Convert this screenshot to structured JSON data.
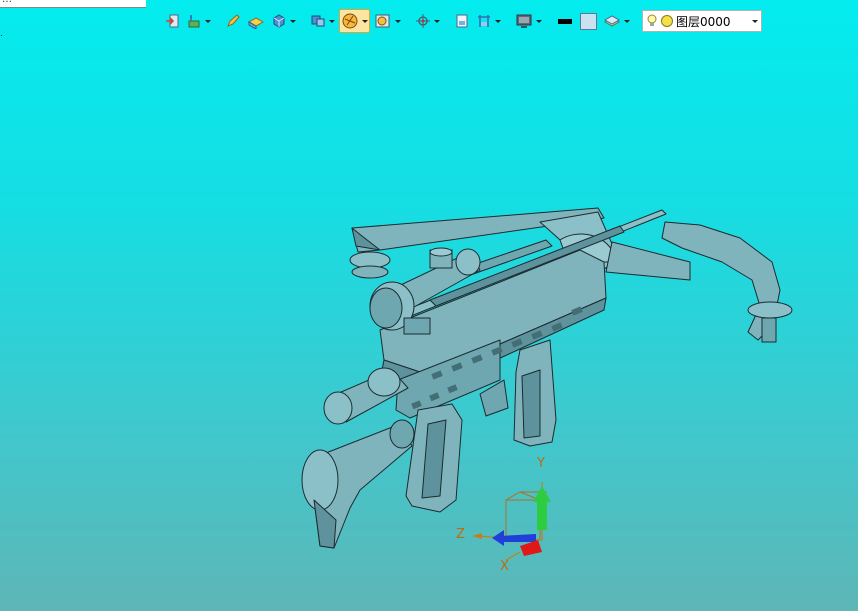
{
  "window": {
    "title_fragment": "…"
  },
  "toolbar": {
    "icons": [
      "exit-icon",
      "snap-icon",
      "pencil-icon",
      "solid-icon",
      "cube-icon",
      "view-cube-icon",
      "render-style-icon",
      "view-orient-icon",
      "pan-target-icon",
      "section-icon",
      "clipping-icon",
      "display-icon",
      "line-color-swatch",
      "fill-color-swatch",
      "layer-settings-icon"
    ],
    "layer": {
      "value": "图层0000"
    }
  },
  "viewport": {
    "background_top": "#03ecef",
    "background_bottom": "#5eb6b6",
    "model_color": "#6fa7b0",
    "triad": {
      "x_label": "X",
      "y_label": "Y",
      "z_label": "Z"
    }
  }
}
